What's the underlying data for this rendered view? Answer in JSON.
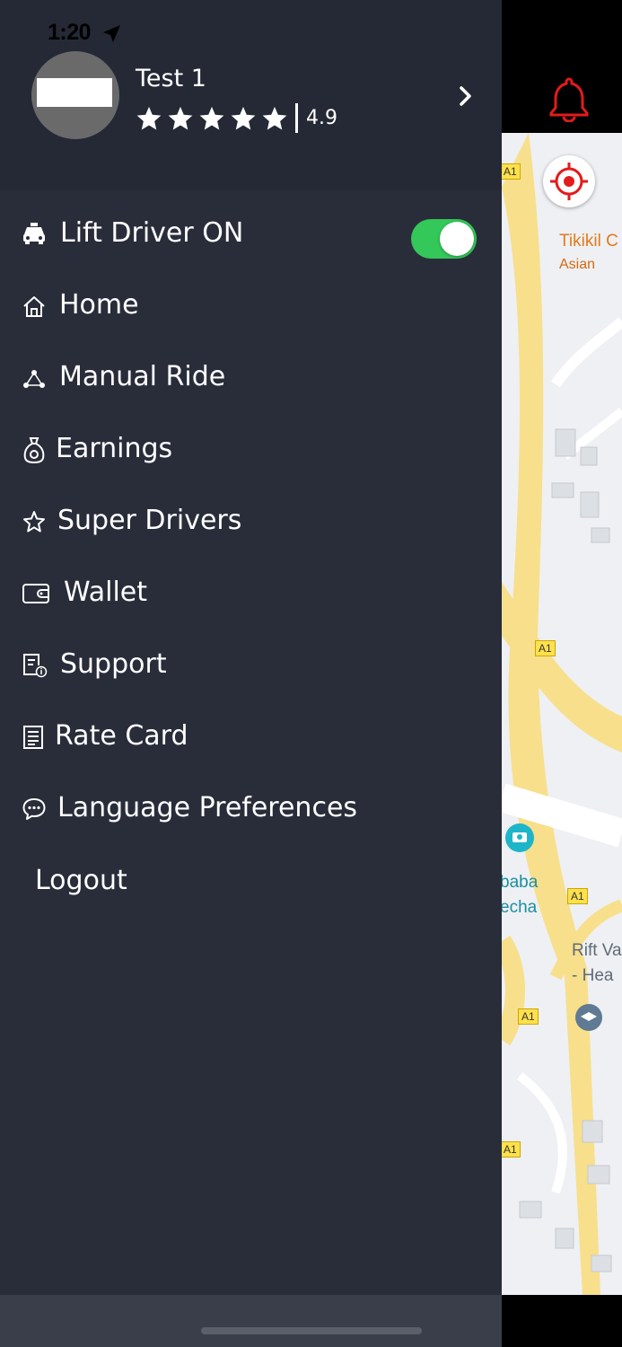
{
  "status_bar": {
    "time": "1:20"
  },
  "profile": {
    "name": "Test 1",
    "rating": "4.9",
    "stars": 5
  },
  "menu": {
    "items": [
      {
        "label": "Lift Driver ON",
        "icon": "car-icon"
      },
      {
        "label": "Home",
        "icon": "home-icon"
      },
      {
        "label": "Manual Ride",
        "icon": "route-nodes-icon"
      },
      {
        "label": "Earnings",
        "icon": "money-bag-icon"
      },
      {
        "label": "Super Drivers",
        "icon": "star-icon"
      },
      {
        "label": "Wallet",
        "icon": "wallet-icon"
      },
      {
        "label": "Support",
        "icon": "support-document-icon"
      },
      {
        "label": "Rate Card",
        "icon": "list-document-icon"
      },
      {
        "label": "Language Preferences",
        "icon": "chat-bubble-icon"
      },
      {
        "label": "Logout"
      }
    ],
    "driver_toggle_on": true
  },
  "map": {
    "labels": {
      "place1": "Tikikil C",
      "place1_sub": "Asian",
      "place2_line1": "baba",
      "place2_line2": "echa",
      "place3_line1": "Rift Va",
      "place3_line2": "- Hea"
    },
    "road_shield": "A1"
  },
  "colors": {
    "drawer_bg": "#292d3a",
    "header_bg": "#252935",
    "toggle_on": "#34c759",
    "alert_red": "#e31b1b",
    "map_road": "#f8df8c"
  }
}
